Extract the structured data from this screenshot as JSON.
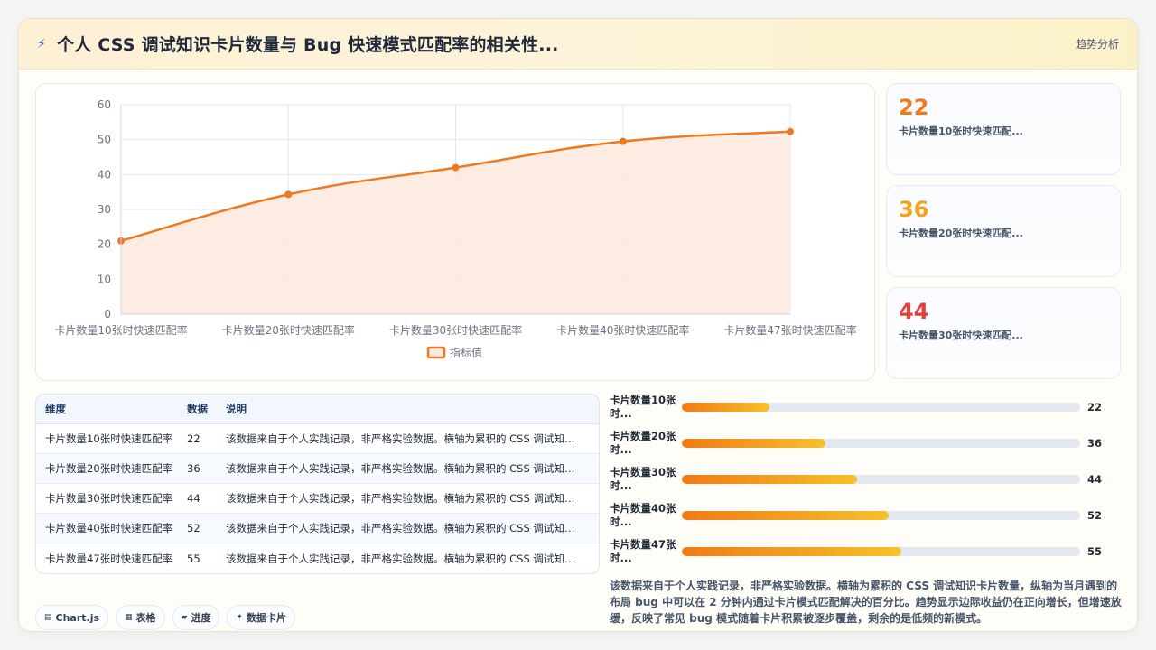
{
  "header": {
    "title_icon": "lightning-icon",
    "title": "个人 CSS 调试知识卡片数量与 Bug 快速模式匹配率的相关性...",
    "right_label": "趋势分析"
  },
  "chart_data": {
    "type": "line",
    "categories": [
      "卡片数量10张时快速匹配率",
      "卡片数量20张时快速匹配率",
      "卡片数量30张时快速匹配率",
      "卡片数量40张时快速匹配率",
      "卡片数量47张时快速匹配率"
    ],
    "series": [
      {
        "name": "指标值",
        "values": [
          21,
          34.3,
          42,
          49.5,
          52.3
        ]
      }
    ],
    "yticks": [
      0,
      10,
      20,
      30,
      40,
      50,
      60
    ],
    "ylim": [
      0,
      60
    ],
    "grid": true,
    "fill": true,
    "legend": "bottom",
    "color": "#ed7a22",
    "fill_color": "#fdeadf"
  },
  "stats": [
    {
      "value": "22",
      "label": "卡片数量10张时快速匹配...",
      "color": "#f07a1a"
    },
    {
      "value": "36",
      "label": "卡片数量20张时快速匹配...",
      "color": "#f5a11c"
    },
    {
      "value": "44",
      "label": "卡片数量30张时快速匹配...",
      "color": "#e0413a"
    }
  ],
  "table": {
    "headers": [
      "维度",
      "数据",
      "说明"
    ],
    "rows": [
      [
        "卡片数量10张时快速匹配率",
        "22",
        "该数据来自于个人实践记录，非严格实验数据。横轴为累积的 CSS 调试知识卡片数量，纵轴为当月"
      ],
      [
        "卡片数量20张时快速匹配率",
        "36",
        "该数据来自于个人实践记录，非严格实验数据。横轴为累积的 CSS 调试知识卡片数量，纵轴为当月"
      ],
      [
        "卡片数量30张时快速匹配率",
        "44",
        "该数据来自于个人实践记录，非严格实验数据。横轴为累积的 CSS 调试知识卡片数量，纵轴为当月"
      ],
      [
        "卡片数量40张时快速匹配率",
        "52",
        "该数据来自于个人实践记录，非严格实验数据。横轴为累积的 CSS 调试知识卡片数量，纵轴为当月"
      ],
      [
        "卡片数量47张时快速匹配率",
        "55",
        "该数据来自于个人实践记录，非严格实验数据。横轴为累积的 CSS 调试知识卡片数量，纵轴为当月"
      ]
    ]
  },
  "progress": {
    "max": 100,
    "items": [
      {
        "label": "卡片数量10张时...",
        "value": 22
      },
      {
        "label": "卡片数量20张时...",
        "value": 36
      },
      {
        "label": "卡片数量30张时...",
        "value": 44
      },
      {
        "label": "卡片数量40张时...",
        "value": 52
      },
      {
        "label": "卡片数量47张时...",
        "value": 55
      }
    ]
  },
  "description": "该数据来自于个人实践记录，非严格实验数据。横轴为累积的 CSS 调试知识卡片数量，纵轴为当月遇到的布局 bug 中可以在 2 分钟内通过卡片模式匹配解决的百分比。趋势显示边际收益仍在正向增长，但增速放缓，反映了常见 bug 模式随着卡片积累被逐步覆盖，剩余的是低频的新模式。",
  "tags": [
    {
      "icon": "chart-icon",
      "glyph": "▤",
      "label": "Chart.js"
    },
    {
      "icon": "table-icon",
      "glyph": "▦",
      "label": "表格"
    },
    {
      "icon": "folder-icon",
      "glyph": "▰",
      "label": "进度"
    },
    {
      "icon": "sparkle-icon",
      "glyph": "✦",
      "label": "数据卡片"
    }
  ]
}
